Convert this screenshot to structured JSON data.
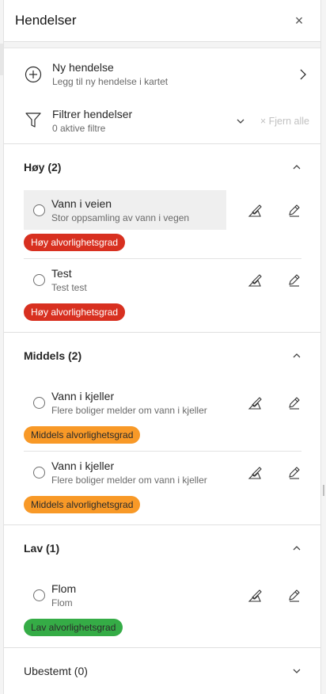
{
  "header": {
    "title": "Hendelser",
    "close_label": "×"
  },
  "new_incident": {
    "title": "Ny hendelse",
    "subtitle": "Legg til ny hendelse i kartet"
  },
  "filter": {
    "title": "Filtrer hendelser",
    "subtitle": "0 aktive filtre",
    "clear_label": "× Fjern alle"
  },
  "groups": [
    {
      "title": "Høy (2)",
      "items": [
        {
          "title": "Vann i veien",
          "description": "Stor oppsamling av vann i vegen",
          "badge": "Høy alvorlighetsgrad",
          "highlighted": true
        },
        {
          "title": "Test",
          "description": "Test test",
          "badge": "Høy alvorlighetsgrad",
          "highlighted": false
        }
      ]
    },
    {
      "title": "Middels (2)",
      "items": [
        {
          "title": "Vann i kjeller",
          "description": "Flere boliger melder om vann i kjeller",
          "badge": "Middels alvorlighetsgrad"
        },
        {
          "title": "Vann i kjeller",
          "description": "Flere boliger melder om vann i kjeller",
          "badge": "Middels alvorlighetsgrad"
        }
      ]
    },
    {
      "title": "Lav (1)",
      "items": [
        {
          "title": "Flom",
          "description": "Flom",
          "badge": "Lav alvorlighetsgrad"
        }
      ]
    },
    {
      "title": "Ubestemt (0)",
      "items": []
    }
  ],
  "colors": {
    "high": "#d83020",
    "medium": "#f89927",
    "low": "#35ac46"
  },
  "icons": [
    "close-icon",
    "add-circle-icon",
    "chevron-right-icon",
    "filter-icon",
    "chevron-down-icon",
    "chevron-up-icon",
    "edit-location-icon",
    "pencil-icon"
  ]
}
